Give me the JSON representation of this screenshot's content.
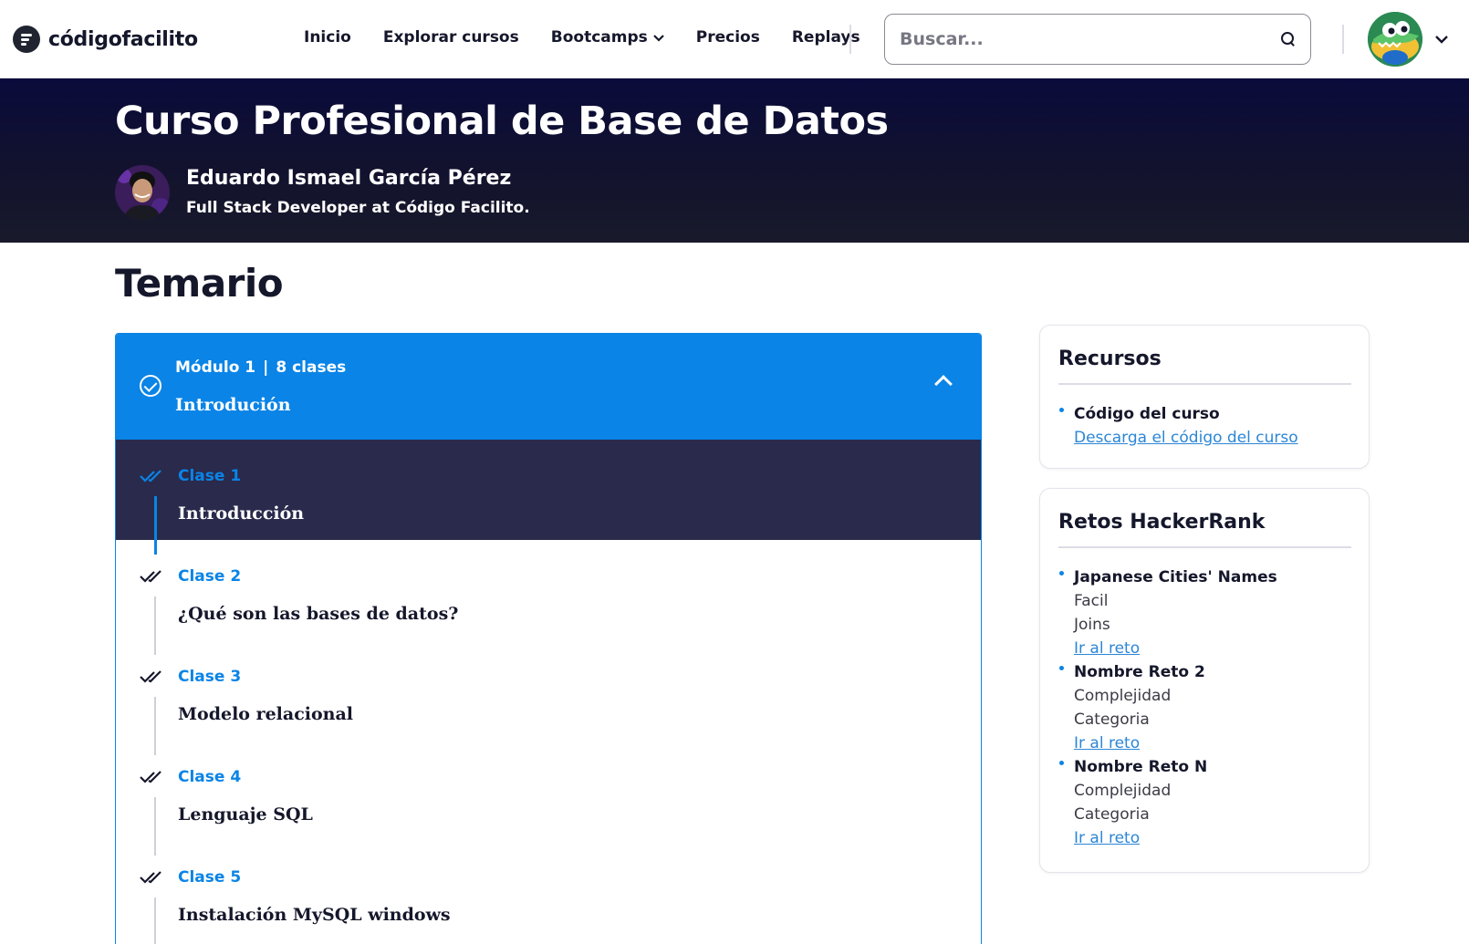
{
  "nav": {
    "brand": "códigofacilito",
    "links": [
      {
        "label": "Inicio"
      },
      {
        "label": "Explorar cursos"
      },
      {
        "label": "Bootcamps",
        "dropdown": true
      },
      {
        "label": "Precios"
      },
      {
        "label": "Replays"
      }
    ],
    "search_placeholder": "Buscar..."
  },
  "hero": {
    "title": "Curso Profesional de Base de Datos",
    "instructor_name": "Eduardo Ismael García Pérez",
    "instructor_role": "Full Stack Developer at Código Facilito."
  },
  "temario": {
    "title": "Temario",
    "module": {
      "label": "Módulo 1",
      "count": "8 clases",
      "name": "Introdución",
      "expanded": true
    },
    "lessons": [
      {
        "label": "Clase 1",
        "title": "Introducción",
        "active": true
      },
      {
        "label": "Clase 2",
        "title": "¿Qué son las bases de datos?",
        "active": false
      },
      {
        "label": "Clase 3",
        "title": "Modelo relacional",
        "active": false
      },
      {
        "label": "Clase 4",
        "title": "Lenguaje SQL",
        "active": false
      },
      {
        "label": "Clase 5",
        "title": "Instalación MySQL windows",
        "active": false
      }
    ]
  },
  "recursos": {
    "title": "Recursos",
    "items": [
      {
        "name": "Código del curso",
        "link": "Descarga el código del curso"
      }
    ]
  },
  "retos": {
    "title": "Retos HackerRank",
    "items": [
      {
        "name": "Japanese Cities' Names",
        "difficulty": "Facil",
        "category": "Joins",
        "link": "Ir al reto"
      },
      {
        "name": "Nombre Reto 2",
        "difficulty": "Complejidad",
        "category": "Categoria",
        "link": "Ir al reto"
      },
      {
        "name": "Nombre Reto N",
        "difficulty": "Complejidad",
        "category": "Categoria",
        "link": "Ir al reto"
      }
    ]
  },
  "colors": {
    "accent": "#0a84e6",
    "hero_bg": "#0a0b3b",
    "active_lesson_bg": "#292a4c",
    "link": "#2b86d6"
  },
  "icons": {
    "module_status": "check-circle-icon",
    "lesson_status": "double-check-icon",
    "toggle": "chevron-up-icon",
    "search": "search-icon",
    "user_menu": "chevron-down-icon"
  }
}
